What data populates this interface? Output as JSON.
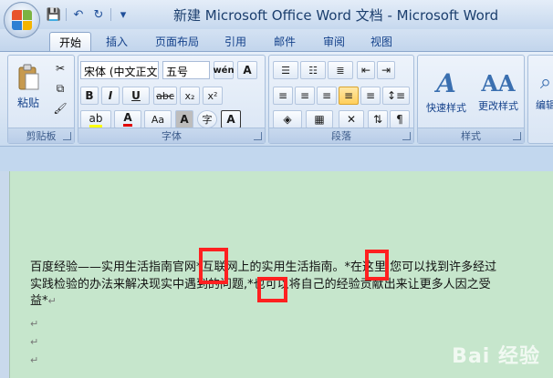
{
  "window": {
    "title": "新建 Microsoft Office Word 文档 - Microsoft Word"
  },
  "quick_access": {
    "save": "💾",
    "undo": "↶",
    "redo": "↻",
    "more": "▾"
  },
  "tabs": [
    {
      "label": "开始"
    },
    {
      "label": "插入"
    },
    {
      "label": "页面布局"
    },
    {
      "label": "引用"
    },
    {
      "label": "邮件"
    },
    {
      "label": "审阅"
    },
    {
      "label": "视图"
    }
  ],
  "ribbon": {
    "clipboard": {
      "label": "剪贴板",
      "paste": "粘贴"
    },
    "font": {
      "label": "字体",
      "font_name": "宋体 (中文正文",
      "font_size": "五号",
      "grow": "A",
      "phonetic": "wén",
      "bold": "B",
      "italic": "I",
      "underline": "U",
      "strike": "abc",
      "subscript": "x₂",
      "superscript": "x²",
      "font_color": "A",
      "change_case": "Aa",
      "char_shade": "A",
      "enclose": "字"
    },
    "paragraph": {
      "label": "段落"
    },
    "styles": {
      "label": "样式",
      "quick_style": "快速样式",
      "change_style": "更改样式"
    },
    "editing": {
      "label": "编辑"
    }
  },
  "document": {
    "line1": "百度经验——实用生活指南官网*互联网上的实用生活指南。*在这里,您可以找到许多经过",
    "line2": "实践检验的办法来解决现实中遇到的问题,*也可以将自己的经验贡献出来让更多人因之受",
    "line3": "益*",
    "para_mark": "↵"
  },
  "watermark": {
    "text": "Bai 经验"
  }
}
